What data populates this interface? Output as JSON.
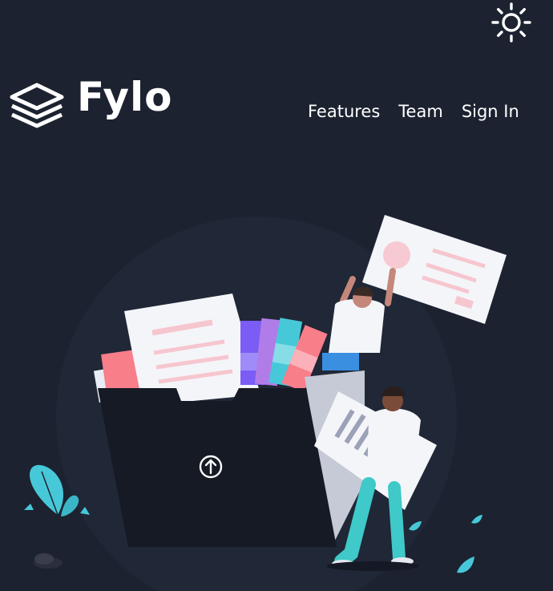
{
  "brand": {
    "name": "Fylo"
  },
  "nav": {
    "items": [
      {
        "label": "Features"
      },
      {
        "label": "Team"
      },
      {
        "label": "Sign In"
      }
    ]
  },
  "theme_toggle": {
    "icon": "sun-icon"
  },
  "hero": {
    "illustration": "file-upload-people-illustration",
    "upload_icon": "arrow-up-circle-icon"
  },
  "colors": {
    "background": "#1c2230",
    "text": "#ffffff",
    "folder": "#151a24",
    "accent_cyan": "#47c8d8",
    "accent_pink": "#f87e8a"
  }
}
